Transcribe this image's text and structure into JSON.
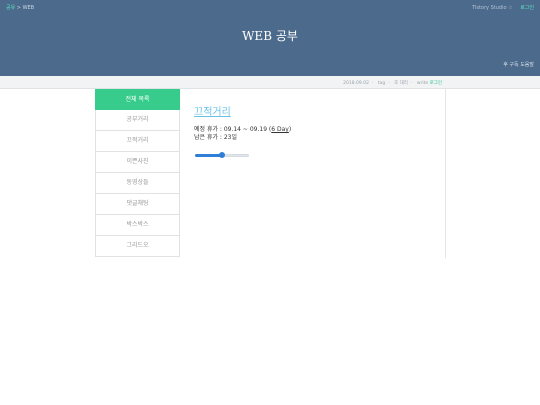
{
  "header": {
    "home_link": "공유",
    "breadcrumb": "> WEB",
    "top_right_text": "Tistory Studio ☆",
    "login": "로그인",
    "title": "WEB 공부",
    "right_text": "후 구독 도움말",
    "bg_color": "#4c6a8c"
  },
  "subbar": {
    "date": "2018.09.02",
    "tag": "tag",
    "views": "조 대리",
    "write": "write",
    "login": "로그인"
  },
  "sidebar": {
    "header": "전체 목록",
    "accent_color": "#37cc8c",
    "items": [
      {
        "label": "공부거리"
      },
      {
        "label": "끄적거리"
      },
      {
        "label": "이쁜사진"
      },
      {
        "label": "동영상들"
      },
      {
        "label": "댓글채팅"
      },
      {
        "label": "박스박스"
      },
      {
        "label": "그리드오"
      }
    ]
  },
  "post": {
    "title": "끄적거리",
    "vacation_label": "예정 휴가 : 09.14 ~ 09.19 (",
    "vacation_days": "6 Day",
    "vacation_close": ")",
    "remaining": "남은 휴가 : 23일",
    "slider_value": 0.5
  }
}
